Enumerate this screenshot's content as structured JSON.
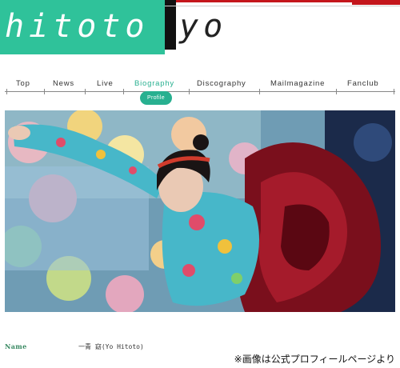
{
  "colors": {
    "logo_green": "#2fc29a",
    "accent": "#28b090"
  },
  "logo": {
    "part1": "hitoto",
    "part2": "yo"
  },
  "nav": {
    "items": [
      "Top",
      "News",
      "Live",
      "Biography",
      "Discography",
      "Mailmagazine",
      "Fanclub"
    ],
    "active": "Biography",
    "sub_tab": "Profile"
  },
  "hero": {
    "alt_desc_icon": "photo-artist"
  },
  "profile": {
    "name_label": "Name",
    "name_value": "一青 窈(Yo Hitoto)"
  },
  "caption": "※画像は公式プロフィールページより"
}
